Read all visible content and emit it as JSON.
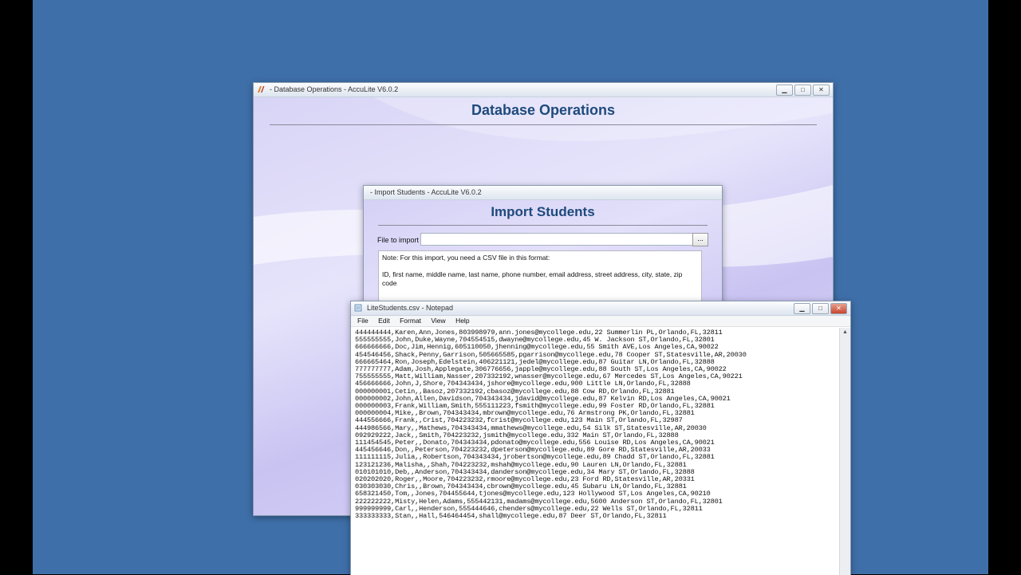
{
  "colors": {
    "desktop": "#3f6fa9",
    "title_blue": "#1e4a7d"
  },
  "db_window": {
    "title": "- Database Operations - AccuLite V6.0.2",
    "heading": "Database Operations",
    "icon": "acculite-app-icon"
  },
  "import_window": {
    "title": "- Import Students - AccuLite V6.0.2",
    "heading": "Import Students",
    "file_label": "File to import",
    "file_value": "",
    "browse_label": "...",
    "note_line1": "Note: For this import, you need a CSV file in this format:",
    "note_line2": "ID, first name, middle name, last name, phone number, email address, street address, city, state, zip code"
  },
  "notepad": {
    "title": "LiteStudents.csv - Notepad",
    "menu": [
      "File",
      "Edit",
      "Format",
      "View",
      "Help"
    ],
    "lines": [
      "444444444,Karen,Ann,Jones,803998979,ann.jones@mycollege.edu,22 Summerlin PL,Orlando,FL,32811",
      "555555555,John,Duke,Wayne,704554515,dwayne@mycollege.edu,45 W. Jackson ST,Orlando,FL,32801",
      "666666666,Doc,Jim,Hennig,605110050,jhenning@mycollege.edu,55 Smith AVE,Los Angeles,CA,90022",
      "454546456,Shack,Penny,Garrison,505665585,pgarrison@mycollege.edu,78 Cooper ST,Statesville,AR,20030",
      "666665464,Ron,Joseph,Edelstein,406221121,jedel@mycollege.edu,87 Guitar LN,Orlando,FL,32888",
      "777777777,Adam,Josh,Applegate,306776656,japple@mycollege.edu,88 South ST,Los Angeles,CA,90022",
      "755555555,Matt,William,Nasser,207332192,wnasser@mycollege.edu,67 Mercedes ST,Los Angeles,CA,90221",
      "456666666,John,J,Shore,704343434,jshore@mycollege.edu,900 Little LN,Orlando,FL,32888",
      "000000001,Cetin,,Basoz,207332192,cbasoz@mycollege.edu,88 Cow RD,Orlando,FL,32881",
      "000000002,John,Allen,Davidson,704343434,jdavid@mycollege.edu,87 Kelvin RD,Los Angeles,CA,90021",
      "000000003,Frank,William,Smith,555111223,fsmith@mycollege.edu,99 Foster RD,Orlando,FL,32881",
      "000000004,Mike,,Brown,704343434,mbrown@mycollege.edu,76 Armstrong PK,Orlando,FL,32881",
      "444556666,Frank,,Crist,704223232,fcrist@mycollege.edu,123 Main ST,Orlando,FL,32987",
      "444986566,Mary,,Mathews,704343434,mmathews@mycollege.edu,54 Silk ST,Statesville,AR,20030",
      "092929222,Jack,,Smith,704223232,jsmith@mycollege.edu,332 Main ST,Orlando,FL,32888",
      "111454545,Peter,,Donato,704343434,pdonato@mycollege.edu,556 Louise RD,Los Angeles,CA,90021",
      "445456646,Don,,Peterson,704223232,dpeterson@mycollege.edu,89 Gore RD,Statesville,AR,20033",
      "111111115,Julia,,Robertson,704343434,jrobertson@mycollege.edu,89 Chadd ST,Orlando,FL,32881",
      "123121236,Malisha,,Shah,704223232,mshah@mycollege.edu,90 Lauren LN,Orlando,FL,32881",
      "010101010,Deb,,Anderson,704343434,danderson@mycollege.edu,34 Mary ST,Orlando,FL,32888",
      "020202020,Roger,,Moore,704223232,rmoore@mycollege.edu,23 Ford RD,Statesville,AR,20331",
      "030303030,Chris,,Brown,704343434,cbrown@mycollege.edu,45 Subaru LN,Orlando,FL,32881",
      "658321450,Tom,,Jones,704455644,tjones@mycollege.edu,123 Hollywood ST,Los Angeles,CA,90210",
      "222222222,Misty,Helen,Adams,555442131,madams@mycollege.edu,5600 Anderson ST,Orlando,FL,32801",
      "999999999,Carl,,Henderson,555444646,chenders@mycollege.edu,22 Wells ST,Orlando,FL,32811",
      "333333333,Stan,,Hall,546464454,shall@mycollege.edu,87 Deer ST,Orlando,FL,32811"
    ]
  }
}
